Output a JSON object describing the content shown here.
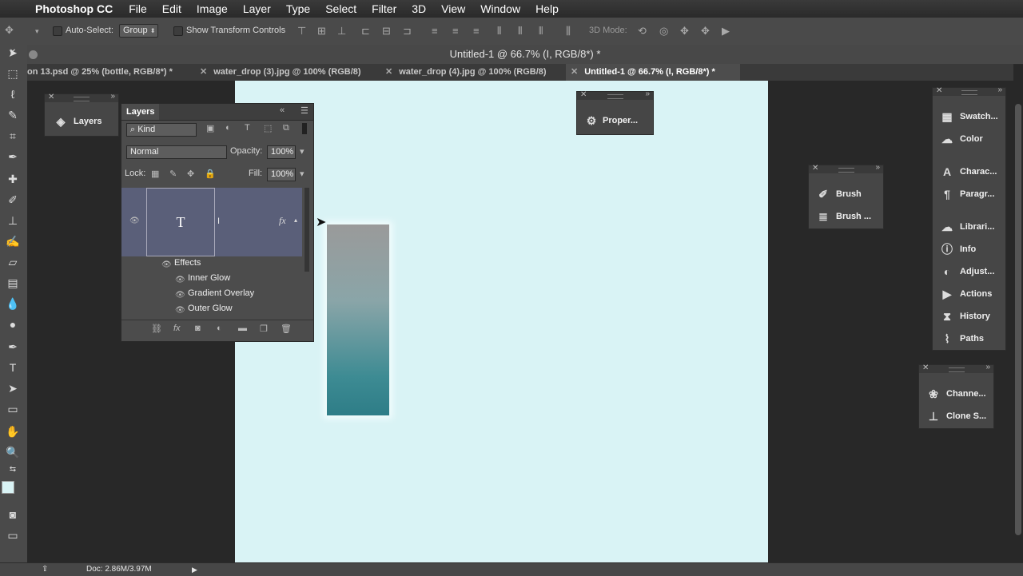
{
  "menubar": {
    "app": "Photoshop CC",
    "items": [
      "File",
      "Edit",
      "Image",
      "Layer",
      "Type",
      "Select",
      "Filter",
      "3D",
      "View",
      "Window",
      "Help"
    ]
  },
  "options": {
    "auto_select_label": "Auto-Select:",
    "auto_select_value": "Group",
    "transform_label": "Show Transform Controls",
    "mode3d_label": "3D Mode:"
  },
  "title": "Untitled-1 @ 66.7% (I, RGB/8*) *",
  "tabs": [
    {
      "label": "on 13.psd @ 25% (bottle, RGB/8*) *",
      "active": false
    },
    {
      "label": "water_drop (3).jpg @ 100% (RGB/8)",
      "active": false
    },
    {
      "label": "water_drop (4).jpg @ 100% (RGB/8)",
      "active": false
    },
    {
      "label": "Untitled-1 @ 66.7% (I, RGB/8*) *",
      "active": true
    }
  ],
  "status": {
    "doc": "Doc: 2.86M/3.97M"
  },
  "layers_panel": {
    "title": "Layers",
    "collapsed_label": "Layers",
    "filter_value": "Kind",
    "blend_mode": "Normal",
    "opacity_label": "Opacity:",
    "opacity_value": "100%",
    "lock_label": "Lock:",
    "fill_label": "Fill:",
    "fill_value": "100%",
    "layer": {
      "thumb_glyph": "T",
      "name": "I",
      "fx": "fx"
    },
    "effects_label": "Effects",
    "effects": [
      "Inner Glow",
      "Gradient Overlay",
      "Outer Glow"
    ]
  },
  "properties_panel": {
    "label": "Proper..."
  },
  "brush_panel": {
    "items": [
      "Brush",
      "Brush ..."
    ]
  },
  "right_panel": {
    "items": [
      "Swatch...",
      "Color",
      "Charac...",
      "Paragr...",
      "Librari...",
      "Info",
      "Adjust...",
      "Actions",
      "History",
      "Paths"
    ]
  },
  "channels_panel": {
    "items": [
      "Channe...",
      "Clone S..."
    ]
  },
  "colors": {
    "canvas": "#d9f3f5",
    "shape_bottom": "#2e7d87"
  }
}
